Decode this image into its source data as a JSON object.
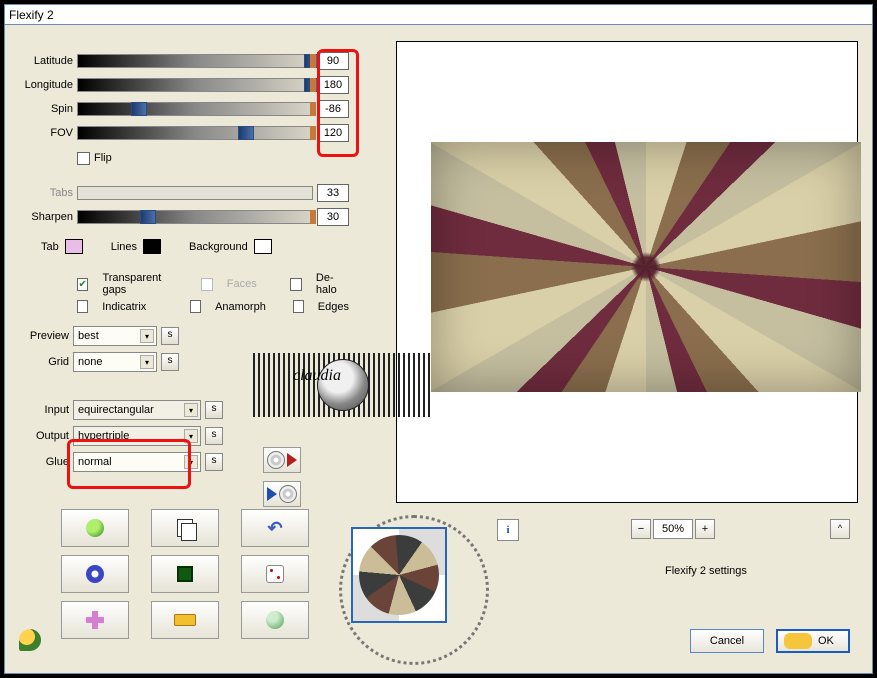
{
  "window": {
    "title": "Flexify 2"
  },
  "sliders": {
    "latitude": {
      "label": "Latitude",
      "value": "90",
      "pos": 100
    },
    "longitude": {
      "label": "Longitude",
      "value": "180",
      "pos": 100
    },
    "spin": {
      "label": "Spin",
      "value": "-86",
      "pos": 26
    },
    "fov": {
      "label": "FOV",
      "value": "120",
      "pos": 72
    },
    "tabs": {
      "label": "Tabs",
      "value": "33",
      "pos": 0,
      "disabled": true
    },
    "sharpen": {
      "label": "Sharpen",
      "value": "30",
      "pos": 30
    }
  },
  "flip": {
    "label": "Flip",
    "checked": false
  },
  "colors": {
    "tab_label": "Tab",
    "tab_color": "#e8bde8",
    "lines_label": "Lines",
    "lines_color": "#000000",
    "bg_label": "Background",
    "bg_color": "#ffffff"
  },
  "options": {
    "transparent_gaps": {
      "label": "Transparent gaps",
      "checked": true
    },
    "faces": {
      "label": "Faces",
      "checked": false,
      "disabled": true
    },
    "dehalo": {
      "label": "De-halo",
      "checked": false
    },
    "indicatrix": {
      "label": "Indicatrix",
      "checked": false
    },
    "anamorph": {
      "label": "Anamorph",
      "checked": false
    },
    "edges": {
      "label": "Edges",
      "checked": false
    }
  },
  "combos": {
    "preview": {
      "label": "Preview",
      "value": "best"
    },
    "grid": {
      "label": "Grid",
      "value": "none"
    },
    "input": {
      "label": "Input",
      "value": "equirectangular"
    },
    "output": {
      "label": "Output",
      "value": "hypertriple"
    },
    "glue": {
      "label": "Glue",
      "value": "normal"
    }
  },
  "s_btn": "s",
  "watermark": "claudia",
  "info_btn": "i",
  "zoom": {
    "minus": "−",
    "value": "50%",
    "plus": "+"
  },
  "carat": "^",
  "settings_label": "Flexify 2 settings",
  "buttons": {
    "cancel": "Cancel",
    "ok": "OK"
  }
}
